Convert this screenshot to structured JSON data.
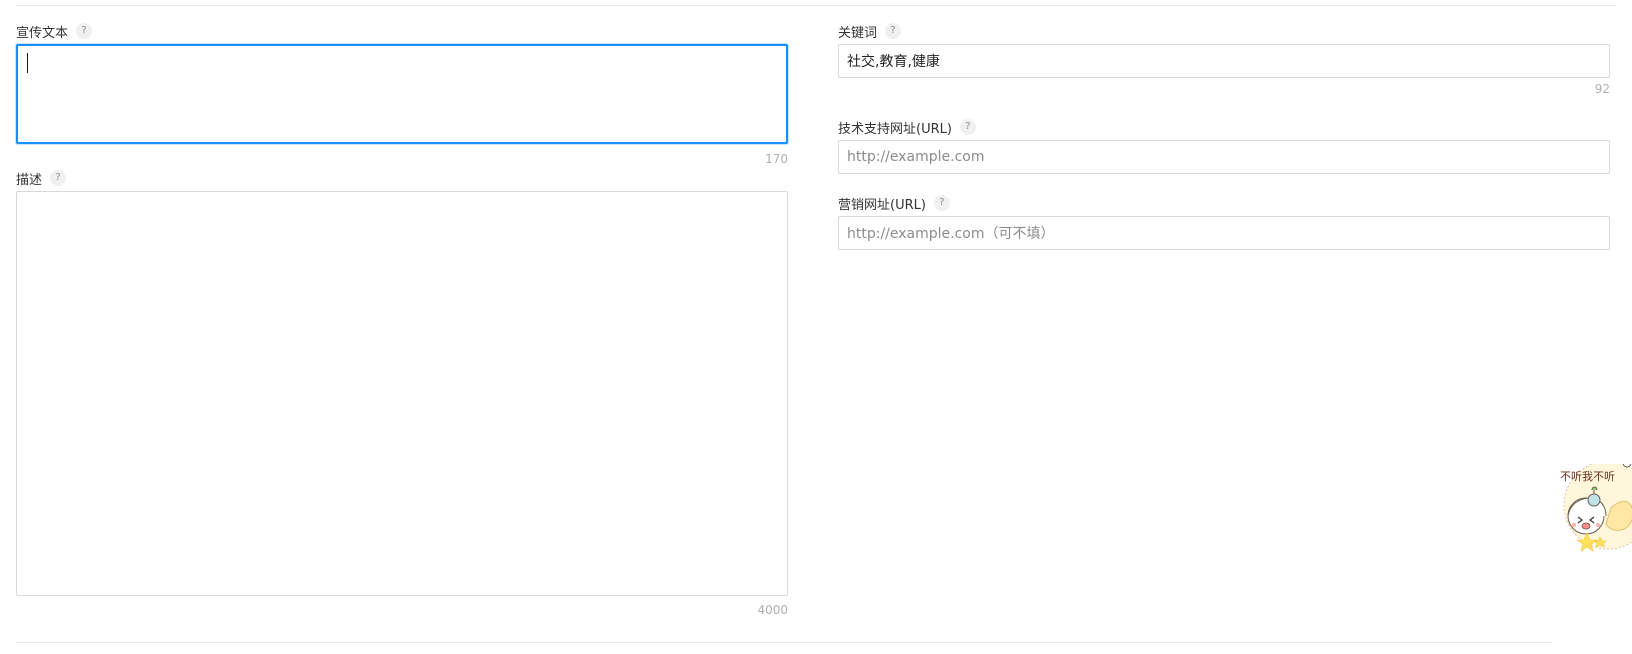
{
  "left_column": {
    "promo_text": {
      "label": "宣传文本",
      "help": "?",
      "value": "",
      "counter": "170"
    },
    "description": {
      "label": "描述",
      "help": "?",
      "value": "",
      "counter": "4000"
    }
  },
  "right_column": {
    "keywords": {
      "label": "关键词",
      "help": "?",
      "value": "社交,教育,健康",
      "counter": "92"
    },
    "support_url": {
      "label": "技术支持网址(URL)",
      "help": "?",
      "placeholder": "http://example.com"
    },
    "marketing_url": {
      "label": "营销网址(URL)",
      "help": "?",
      "placeholder": "http://example.com（可不填）"
    }
  },
  "sticker": {
    "text": "不听我不听",
    "icon": "cartoon-ghost-sticker-icon"
  },
  "colors": {
    "focus": "#1890ff",
    "border": "#d9d9d9",
    "placeholder": "#8c8c8c"
  }
}
